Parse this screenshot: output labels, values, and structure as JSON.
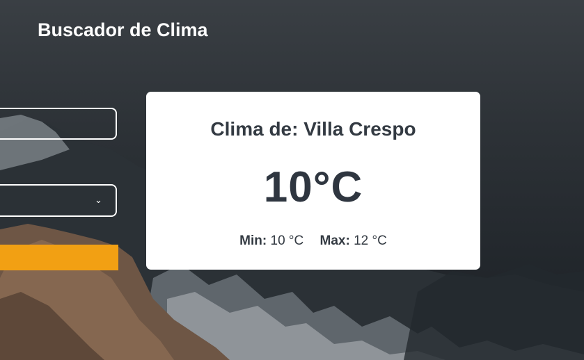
{
  "header": {
    "title": "Buscador de Clima"
  },
  "form": {
    "city_value": "",
    "country_value": "",
    "submit_label": ""
  },
  "result": {
    "title": "Clima de: Villa Crespo",
    "temperature": "10°C",
    "min_label": "Min:",
    "min_value": "10 °C",
    "max_label": "Max:",
    "max_value": "12 °C"
  },
  "colors": {
    "accent": "#f2a013",
    "card_bg": "#ffffff",
    "text": "#2f3640"
  }
}
